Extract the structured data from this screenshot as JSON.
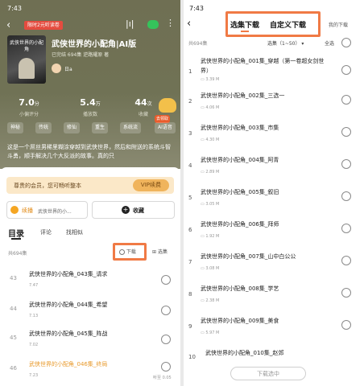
{
  "left": {
    "status_time": "7:43",
    "promo_badge": "限时2元听读卷",
    "cover_text": "武侠世界的小配角",
    "title": "武侠世界的小配角|AI版",
    "meta": "已完结 694集 逆路耀原 著",
    "author_name": "日a",
    "stats": [
      {
        "value": "7.0",
        "unit": "分",
        "label": "小偏评分"
      },
      {
        "value": "5.4",
        "unit": "万",
        "label": "播放数"
      },
      {
        "value": "44",
        "unit": "次",
        "label": "收藏"
      }
    ],
    "tags": [
      "神秘",
      "传统",
      "修仙",
      "重生",
      "系统流",
      "AI语音"
    ],
    "bubble_text": "去领取",
    "description": "这是一个屌丝男稀里糊涂穿越到武侠世界，然后和附送的系统斗智斗勇，顺手解决几个大反派的故事。真的只",
    "vip_banner": "尊贵的会员，您可畅听整本",
    "vip_button": "VIP续费",
    "continue_label": "续播",
    "continue_detail": "武侠世界的小...",
    "collect_label": "收藏",
    "tabs": [
      "目录",
      "评论",
      "找相似"
    ],
    "episode_count": "共694集",
    "download_label": "下载",
    "select_label": "选集",
    "episodes": [
      {
        "num": "43",
        "title": "武侠世界的小配角_043集_请求",
        "plays": "7.47"
      },
      {
        "num": "44",
        "title": "武侠世界的小配角_044集_希望",
        "plays": "7.13"
      },
      {
        "num": "45",
        "title": "武侠世界的小配角_045集_阵战",
        "plays": "7.02"
      },
      {
        "num": "46",
        "title": "武侠世界的小配角_046集_终局",
        "plays": "7.23",
        "extra": "听至 0.05"
      }
    ]
  },
  "right": {
    "status_time": "7:43",
    "tab_select": "选集下载",
    "tab_custom": "自定义下载",
    "my_downloads": "我的下载",
    "episode_count": "共694集",
    "range_label": "选集（1~50）",
    "select_all": "全选",
    "items": [
      {
        "num": "1",
        "title": "武侠世界的小配角_001集_穿越（第一卷超女剑世界）",
        "size": "3.39 M"
      },
      {
        "num": "2",
        "title": "武侠世界的小配角_002集_三选一",
        "size": "4.06 M"
      },
      {
        "num": "3",
        "title": "武侠世界的小配角_003集_市集",
        "size": "4.30 M"
      },
      {
        "num": "4",
        "title": "武侠世界的小配角_004集_阿青",
        "size": "2.89 M"
      },
      {
        "num": "5",
        "title": "武侠世界的小配角_005集_叙旧",
        "size": "3.05 M"
      },
      {
        "num": "6",
        "title": "武侠世界的小配角_006集_拜师",
        "size": "1.92 M"
      },
      {
        "num": "7",
        "title": "武侠世界的小配角_007集_山中白公公",
        "size": "3.08 M"
      },
      {
        "num": "8",
        "title": "武侠世界的小配角_008集_学艺",
        "size": "2.38 M"
      },
      {
        "num": "9",
        "title": "武侠世界的小配角_009集_美食",
        "size": "5.97 M"
      },
      {
        "num": "10",
        "title": "武侠世界的小配角_010集_赵郊",
        "size": ""
      }
    ],
    "download_selected": "下载选中"
  },
  "colors": {
    "accent": "#f07a45",
    "hero": "#707255",
    "vip": "#e9a24a"
  }
}
